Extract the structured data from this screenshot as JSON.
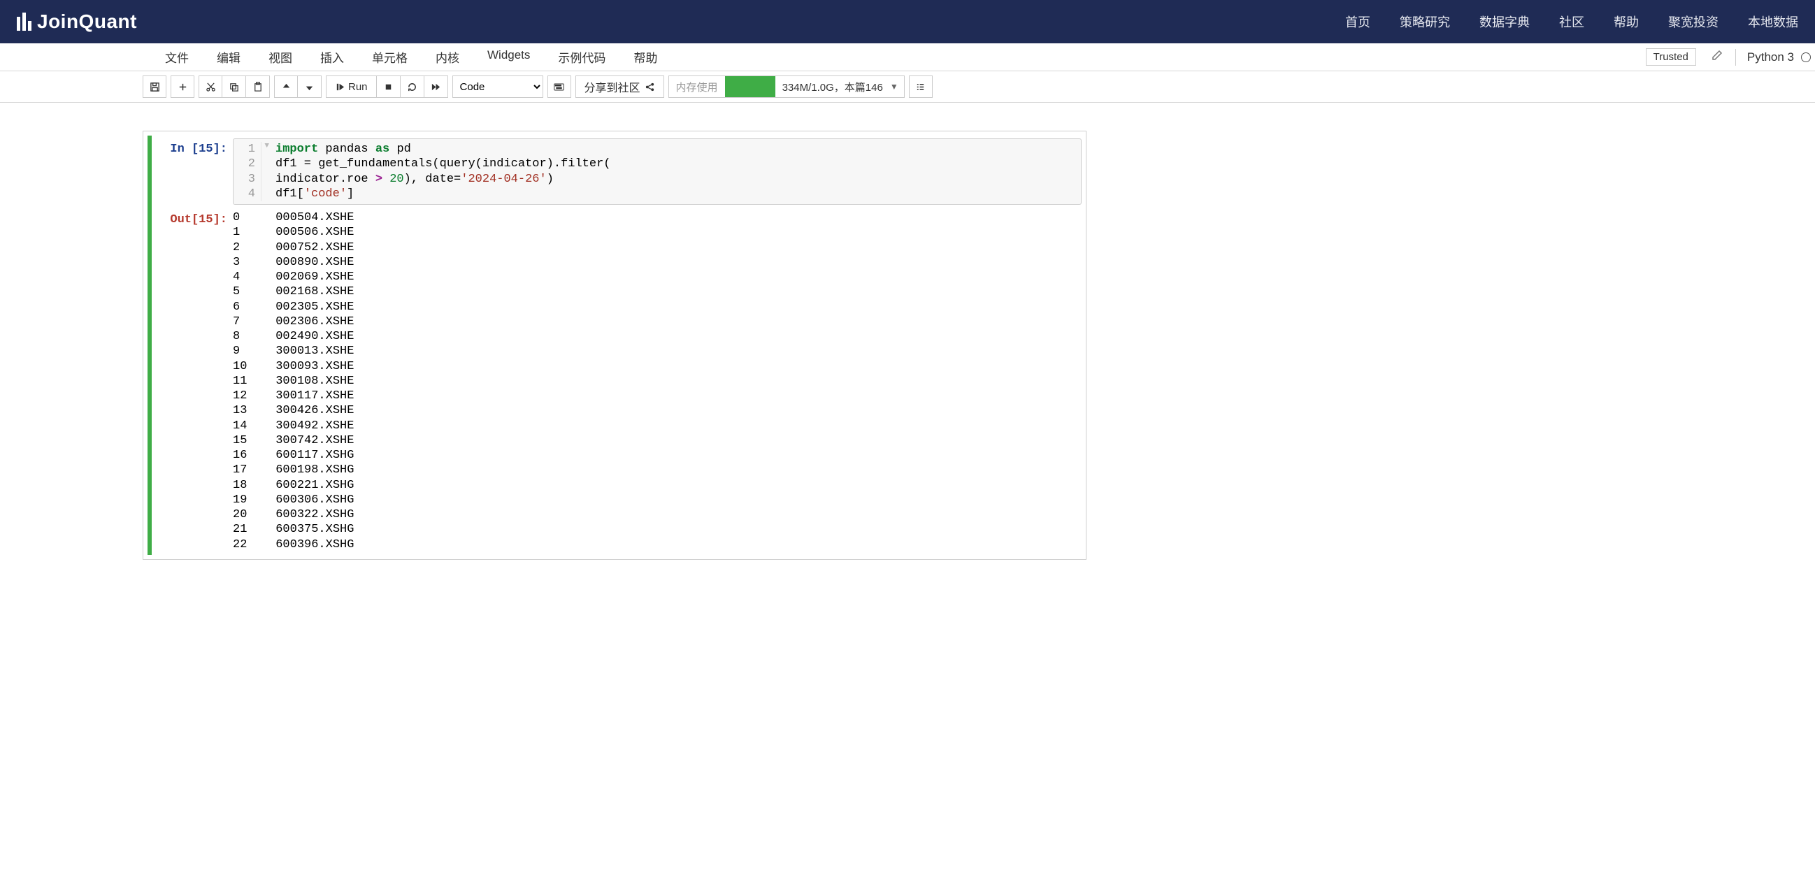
{
  "brand": "JoinQuant",
  "topnav": [
    "首页",
    "策略研究",
    "数据字典",
    "社区",
    "帮助",
    "聚宽投资",
    "本地数据"
  ],
  "menubar": [
    "文件",
    "编辑",
    "视图",
    "插入",
    "单元格",
    "内核",
    "Widgets",
    "示例代码",
    "帮助"
  ],
  "trusted": "Trusted",
  "kernel": "Python 3",
  "toolbar": {
    "run": "Run",
    "celltype": "Code",
    "share": "分享到社区",
    "mem_label": "内存使用",
    "mem_text": "334M/1.0G，本篇146"
  },
  "cell": {
    "in_prompt": "In [15]:",
    "out_prompt": "Out[15]:",
    "code_lines": [
      {
        "n": "1",
        "pre": "",
        "tokens": [
          [
            "kw",
            "import"
          ],
          [
            "",
            " pandas "
          ],
          [
            "kw",
            "as"
          ],
          [
            "",
            " pd"
          ]
        ]
      },
      {
        "n": "2",
        "pre": "",
        "tokens": [
          [
            "",
            "df1 = get_fundamentals(query(indicator).filter("
          ]
        ]
      },
      {
        "n": "3",
        "pre": "",
        "tokens": [
          [
            "",
            "indicator.roe "
          ],
          [
            "op",
            ">"
          ],
          [
            "",
            " "
          ],
          [
            "num",
            "20"
          ],
          [
            "",
            "), date="
          ],
          [
            "str",
            "'2024-04-26'"
          ],
          [
            "",
            ")"
          ]
        ]
      },
      {
        "n": "4",
        "pre": "",
        "tokens": [
          [
            "",
            "df1["
          ],
          [
            "idx",
            "'code'"
          ],
          [
            "",
            "]"
          ]
        ]
      }
    ],
    "output_rows": [
      [
        "0",
        "000504.XSHE"
      ],
      [
        "1",
        "000506.XSHE"
      ],
      [
        "2",
        "000752.XSHE"
      ],
      [
        "3",
        "000890.XSHE"
      ],
      [
        "4",
        "002069.XSHE"
      ],
      [
        "5",
        "002168.XSHE"
      ],
      [
        "6",
        "002305.XSHE"
      ],
      [
        "7",
        "002306.XSHE"
      ],
      [
        "8",
        "002490.XSHE"
      ],
      [
        "9",
        "300013.XSHE"
      ],
      [
        "10",
        "300093.XSHE"
      ],
      [
        "11",
        "300108.XSHE"
      ],
      [
        "12",
        "300117.XSHE"
      ],
      [
        "13",
        "300426.XSHE"
      ],
      [
        "14",
        "300492.XSHE"
      ],
      [
        "15",
        "300742.XSHE"
      ],
      [
        "16",
        "600117.XSHG"
      ],
      [
        "17",
        "600198.XSHG"
      ],
      [
        "18",
        "600221.XSHG"
      ],
      [
        "19",
        "600306.XSHG"
      ],
      [
        "20",
        "600322.XSHG"
      ],
      [
        "21",
        "600375.XSHG"
      ],
      [
        "22",
        "600396.XSHG"
      ]
    ]
  }
}
